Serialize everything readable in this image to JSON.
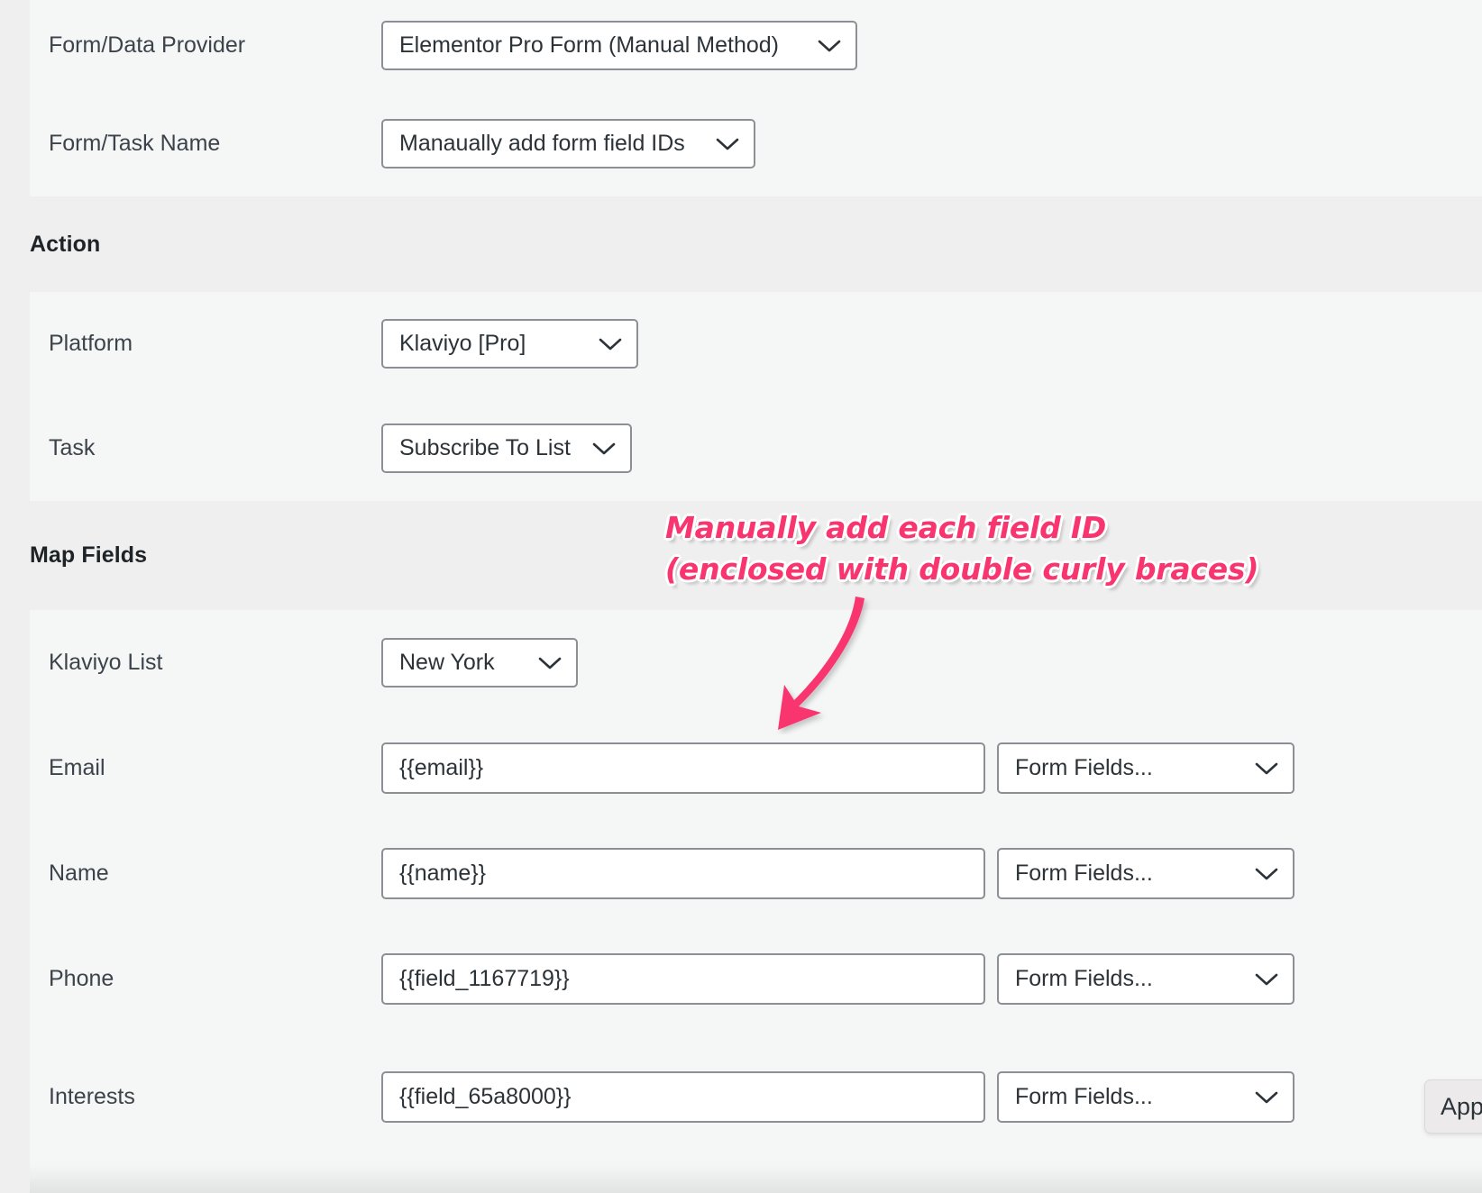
{
  "sections": [
    {
      "id": "form-source",
      "title": "",
      "rows": [
        {
          "label": "Form/Data Provider",
          "control": "select",
          "value": "Elementor Pro Form (Manual Method)"
        },
        {
          "label": "Form/Task Name",
          "control": "select",
          "value": "Manaually add form field IDs"
        }
      ]
    },
    {
      "id": "action",
      "title": "Action",
      "rows": [
        {
          "label": "Platform",
          "control": "select",
          "value": "Klaviyo [Pro]"
        },
        {
          "label": "Task",
          "control": "select",
          "value": "Subscribe To List"
        }
      ]
    },
    {
      "id": "map-fields",
      "title": "Map Fields",
      "rows": [
        {
          "label": "Klaviyo List",
          "control": "select",
          "value": "New York"
        },
        {
          "label": "Email",
          "control": "input-with-select",
          "value": "{{email}}",
          "select_value": "Form Fields..."
        },
        {
          "label": "Name",
          "control": "input-with-select",
          "value": "{{name}}",
          "select_value": "Form Fields..."
        },
        {
          "label": "Phone",
          "control": "input-with-select",
          "value": "{{field_1167719}}",
          "select_value": "Form Fields..."
        },
        {
          "label": "Interests",
          "control": "input-with-select",
          "value": "{{field_65a8000}}",
          "select_value": "Form Fields..."
        }
      ]
    }
  ],
  "labels": {
    "form_data_provider": "Form/Data Provider",
    "form_task_name": "Form/Task Name",
    "action_heading": "Action",
    "platform": "Platform",
    "task": "Task",
    "map_fields_heading": "Map Fields",
    "klaviyo_list": "Klaviyo List",
    "email": "Email",
    "name": "Name",
    "phone": "Phone",
    "interests": "Interests"
  },
  "values": {
    "form_data_provider": "Elementor Pro Form (Manual Method)",
    "form_task_name": "Manaually add form field IDs",
    "platform": "Klaviyo [Pro]",
    "task": "Subscribe To List",
    "klaviyo_list": "New York",
    "email": "{{email}}",
    "name": "{{name}}",
    "phone": "{{field_1167719}}",
    "interests": "{{field_65a8000}}",
    "form_fields_placeholder": "Form Fields..."
  },
  "annotation": {
    "line1": "Manually add each field ID",
    "line2": "(enclosed with double curly braces)",
    "color": "#f9356f"
  },
  "apply_button": {
    "label": "App"
  },
  "colors": {
    "section_header_bg": "#efefef",
    "row_bg": "#f5f6f6",
    "border": "#8c8f94",
    "text": "#2c3338",
    "label_text": "#3c434a",
    "accent_pink": "#f9356f"
  }
}
